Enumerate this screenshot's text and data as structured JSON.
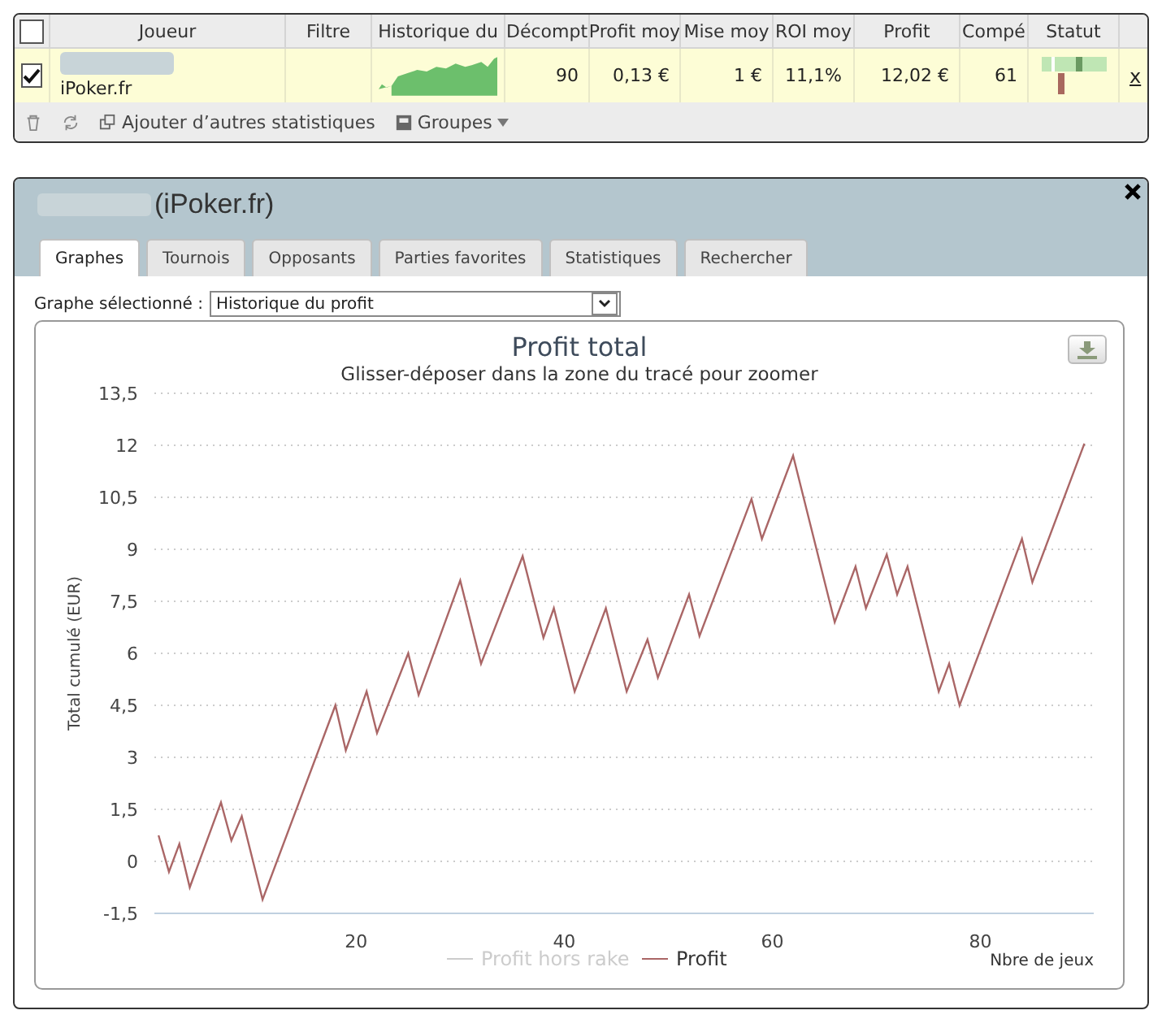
{
  "stats_table": {
    "select_all": {
      "checked": false
    },
    "columns": [
      "Joueur",
      "Filtre",
      "Historique du",
      "Décompt",
      "Profit moy",
      "Mise moy",
      "ROI moy",
      "Profit",
      "Compé",
      "Statut"
    ],
    "rows": [
      {
        "checked": true,
        "site": "iPoker.fr",
        "count": "90",
        "avg_profit": "0,13 €",
        "avg_stake": "1 €",
        "avg_roi": "11,1%",
        "profit": "12,02 €",
        "compe": "61",
        "remove": "x"
      }
    ],
    "toolbar": {
      "add_stats": "Ajouter d’autres statistiques",
      "groups": "Groupes"
    }
  },
  "player_panel": {
    "title": "(iPoker.fr)",
    "tabs": [
      {
        "label": "Graphes",
        "selected": true
      },
      {
        "label": "Tournois",
        "selected": false
      },
      {
        "label": "Opposants",
        "selected": false
      },
      {
        "label": "Parties favorites",
        "selected": false
      },
      {
        "label": "Statistiques",
        "selected": false
      },
      {
        "label": "Rechercher",
        "selected": false
      }
    ],
    "graph_select": {
      "label": "Graphe sélectionné :",
      "value": "Historique du profit"
    },
    "chart": {
      "subtitle": "Glisser-déposer dans la zone du tracé pour zoomer",
      "legend": [
        {
          "label": "Profit hors rake",
          "hidden": true,
          "color": "#cccccc"
        }
      ],
      "chart_data": {
        "type": "line",
        "title": "Profit total",
        "xlabel": "Nbre de jeux",
        "ylabel": "Total cumulé (EUR)",
        "x": [
          1,
          2,
          3,
          4,
          7,
          8,
          9,
          11,
          18,
          19,
          21,
          22,
          25,
          26,
          30,
          32,
          36,
          38,
          39,
          41,
          44,
          46,
          48,
          49,
          52,
          53,
          58,
          59,
          62,
          66,
          68,
          69,
          71,
          72,
          73,
          76,
          77,
          78,
          84,
          85,
          90
        ],
        "series": [
          {
            "name": "Profit",
            "color": "#aa6666",
            "values": [
              0.75,
              -0.3,
              0.5,
              -0.75,
              1.7,
              0.6,
              1.3,
              -1.1,
              4.5,
              3.2,
              4.9,
              3.7,
              6.0,
              4.8,
              8.1,
              5.7,
              8.8,
              6.45,
              7.3,
              4.9,
              7.3,
              4.9,
              6.4,
              5.3,
              7.7,
              6.5,
              10.45,
              9.3,
              11.7,
              6.9,
              8.5,
              7.3,
              8.85,
              7.7,
              8.5,
              4.9,
              5.7,
              4.5,
              9.3,
              8.05,
              12.05
            ]
          }
        ],
        "grid": true,
        "xlim": [
          0.6,
          90.9
        ],
        "ylim": [
          -1.5,
          13.5
        ],
        "xticks": [
          20,
          40,
          60,
          80
        ],
        "yticks": [
          {
            "value": -1.5,
            "label": "-1,5"
          },
          {
            "value": 0,
            "label": "0"
          },
          {
            "value": 1.5,
            "label": "1,5"
          },
          {
            "value": 3,
            "label": "3"
          },
          {
            "value": 4.5,
            "label": "4,5"
          },
          {
            "value": 6,
            "label": "6"
          },
          {
            "value": 7.5,
            "label": "7,5"
          },
          {
            "value": 9,
            "label": "9"
          },
          {
            "value": 10.5,
            "label": "10,5"
          },
          {
            "value": 12,
            "label": "12"
          },
          {
            "value": 13.5,
            "label": "13,5"
          }
        ]
      }
    }
  }
}
